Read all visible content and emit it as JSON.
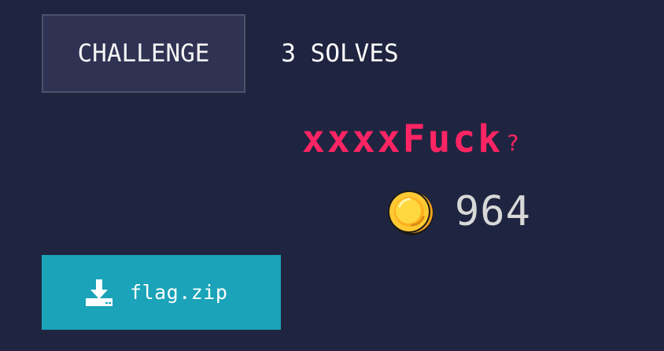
{
  "tabs": {
    "challenge_label": "CHALLENGE",
    "solves_label": "3 SOLVES"
  },
  "challenge": {
    "title": "xxxxFuck",
    "help_symbol": "?",
    "points": "964",
    "coin_icon": "coin-icon"
  },
  "download": {
    "icon": "download-icon",
    "file_name": "flag.zip"
  },
  "colors": {
    "background": "#1f2540",
    "active_tab": "#2f3252",
    "title": "#ff2463",
    "download_button": "#1aa3b9",
    "coin": "#ffc933"
  }
}
